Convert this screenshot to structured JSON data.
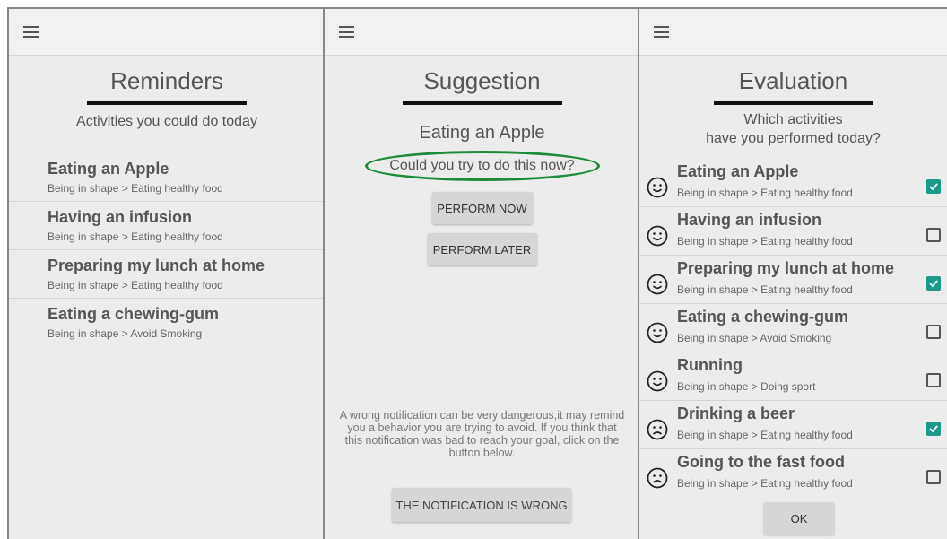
{
  "reminders": {
    "title": "Reminders",
    "subtitle": "Activities you could do today",
    "items": [
      {
        "title": "Eating an Apple",
        "sub": "Being in shape > Eating healthy food"
      },
      {
        "title": "Having an infusion",
        "sub": "Being in shape > Eating healthy food"
      },
      {
        "title": "Preparing my lunch at home",
        "sub": "Being in shape > Eating healthy food"
      },
      {
        "title": "Eating a chewing-gum",
        "sub": "Being in shape > Avoid Smoking"
      }
    ]
  },
  "suggestion": {
    "title": "Suggestion",
    "activity": "Eating an Apple",
    "question": "Could you try to do this now?",
    "perform_now": "PERFORM NOW",
    "perform_later": "PERFORM LATER",
    "warning": "A wrong notification can be very dangerous,it may remind you a behavior you are trying to avoid. If you think that this notification was bad to reach your goal, click on the button below.",
    "wrong_button": "THE NOTIFICATION IS WRONG"
  },
  "evaluation": {
    "title": "Evaluation",
    "question_line1": "Which activities",
    "question_line2": "have you performed today?",
    "ok_button": "OK",
    "check_color": "#1b9a8a",
    "items": [
      {
        "title": "Eating an Apple",
        "sub": "Being in shape > Eating healthy food",
        "face": "smile-face-icon",
        "checked": true
      },
      {
        "title": "Having an infusion",
        "sub": "Being in shape > Eating healthy food",
        "face": "smile-face-icon",
        "checked": false
      },
      {
        "title": "Preparing my lunch at home",
        "sub": "Being in shape > Eating healthy food",
        "face": "smile-face-icon",
        "checked": true
      },
      {
        "title": "Eating a chewing-gum",
        "sub": "Being in shape > Avoid Smoking",
        "face": "smile-face-icon",
        "checked": false
      },
      {
        "title": "Running",
        "sub": "Being in shape > Doing sport",
        "face": "smile-face-icon",
        "checked": false
      },
      {
        "title": "Drinking a beer",
        "sub": "Being in shape > Eating healthy food",
        "face": "frown-face-icon",
        "checked": true
      },
      {
        "title": "Going to the fast food",
        "sub": "Being in shape > Eating healthy food",
        "face": "frown-face-icon",
        "checked": false
      }
    ]
  }
}
